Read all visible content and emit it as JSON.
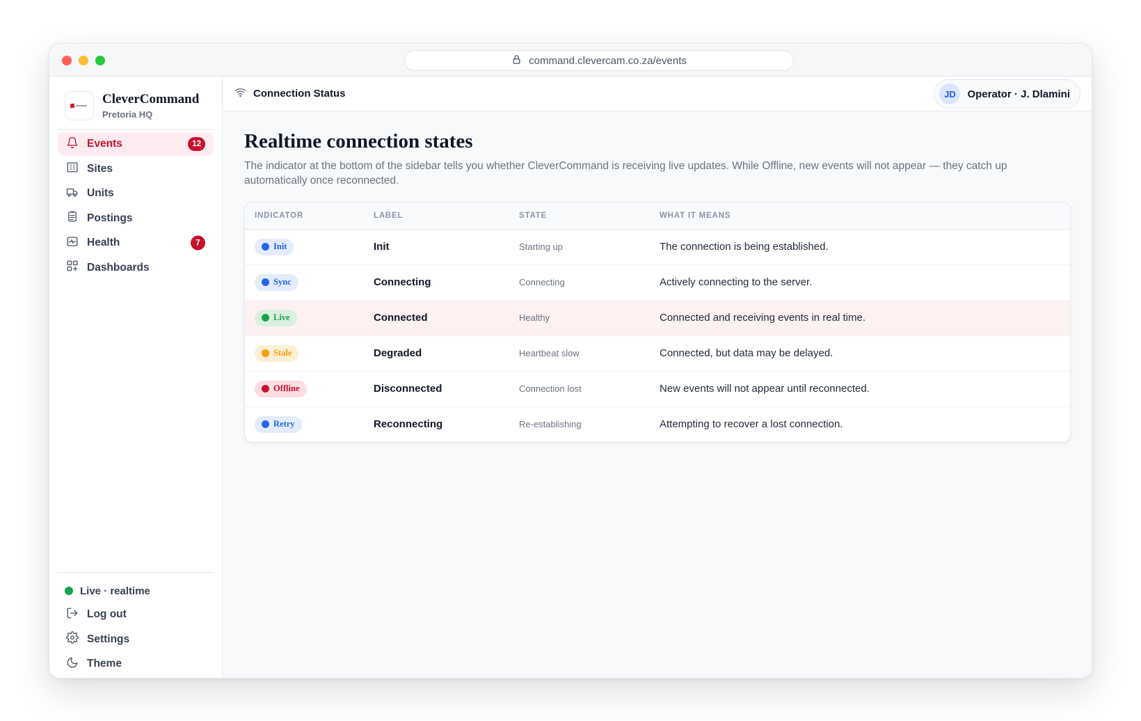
{
  "browser": {
    "url": "command.clevercam.co.za/events"
  },
  "brand": {
    "name": "CleverCommand",
    "location": "Pretoria HQ"
  },
  "sidebar": {
    "items": [
      {
        "label": "Events",
        "badge": "12",
        "icon": "bell-icon",
        "active": true
      },
      {
        "label": "Sites",
        "icon": "building-icon"
      },
      {
        "label": "Units",
        "icon": "truck-icon"
      },
      {
        "label": "Postings",
        "icon": "clipboard-icon"
      },
      {
        "label": "Health",
        "badge": "7",
        "icon": "activity-icon"
      },
      {
        "label": "Dashboards",
        "icon": "grid-plus-icon"
      }
    ],
    "status": "Live · realtime",
    "bottom": [
      {
        "label": "Log out",
        "icon": "logout-icon"
      },
      {
        "label": "Settings",
        "icon": "gear-icon"
      },
      {
        "label": "Theme",
        "icon": "moon-icon"
      }
    ]
  },
  "topbar": {
    "title": "Connection Status",
    "user_initials": "JD",
    "user_name": "Operator · J. Dlamini"
  },
  "page": {
    "title": "Realtime connection states",
    "description": "The indicator at the bottom of the sidebar tells you whether CleverCommand is receiving live updates. While Offline, new events will not appear — they catch up automatically once reconnected."
  },
  "table": {
    "headers": [
      "INDICATOR",
      "LABEL",
      "STATE",
      "WHAT IT MEANS"
    ],
    "rows": [
      {
        "indicator": "Init",
        "color": "#2563eb",
        "bg": "#e3ebfc",
        "label": "Init",
        "state": "Starting up",
        "meaning": "The connection is being established."
      },
      {
        "indicator": "Sync",
        "color": "#2563eb",
        "bg": "#e3ebfc",
        "label": "Connecting",
        "state": "Connecting",
        "meaning": "Actively connecting to the server."
      },
      {
        "indicator": "Live",
        "color": "#16a34a",
        "bg": "#d9f0df",
        "label": "Connected",
        "state": "Healthy",
        "meaning": "Connected and receiving events in real time.",
        "highlight": true
      },
      {
        "indicator": "Stale",
        "color": "#f59e0b",
        "bg": "#fdefd3",
        "label": "Degraded",
        "state": "Heartbeat slow",
        "meaning": "Connected, but data may be delayed."
      },
      {
        "indicator": "Offline",
        "color": "#c8102e",
        "bg": "#fbdde2",
        "label": "Disconnected",
        "state": "Connection lost",
        "meaning": "New events will not appear until reconnected."
      },
      {
        "indicator": "Retry",
        "color": "#2563eb",
        "bg": "#e3ebfc",
        "label": "Reconnecting",
        "state": "Re-establishing",
        "meaning": "Attempting to recover a lost connection."
      }
    ]
  }
}
